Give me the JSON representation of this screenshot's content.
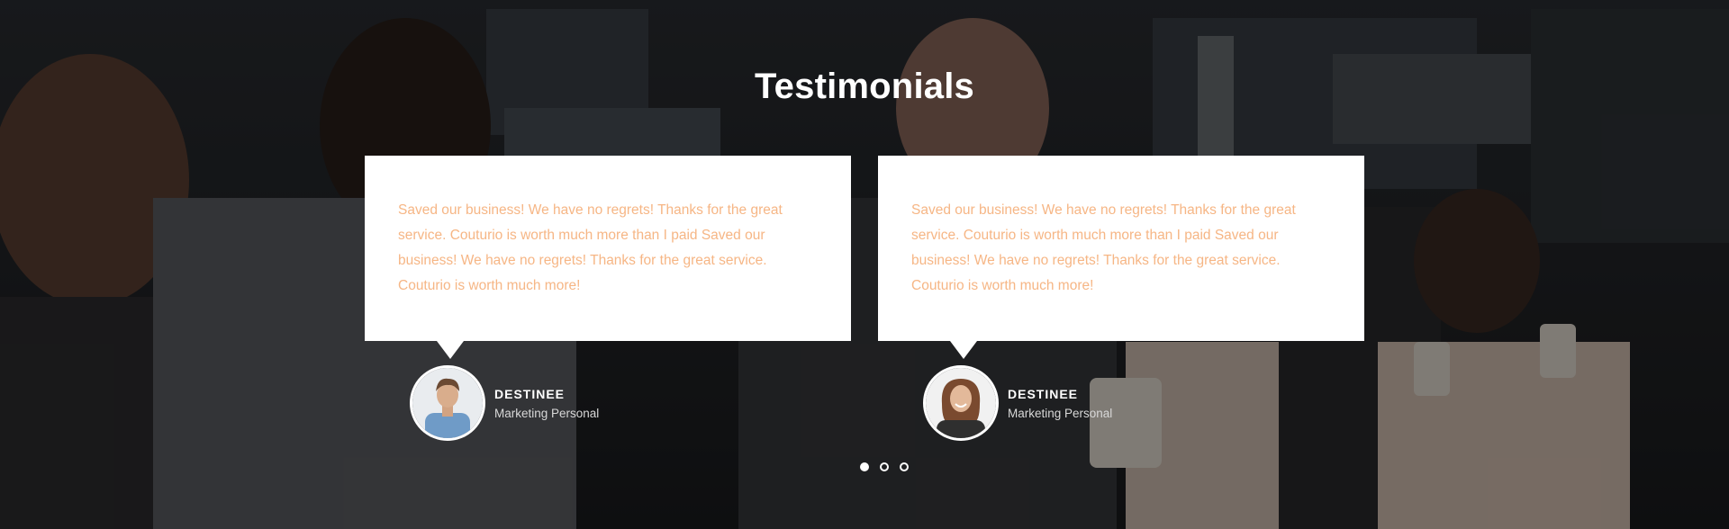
{
  "section": {
    "title": "Testimonials"
  },
  "testimonials": [
    {
      "quote": "Saved our business! We have no regrets! Thanks for the great service. Couturio is worth much more than I paid Saved our business! We have no regrets! Thanks for the great service. Couturio is worth much more!",
      "name": "DESTINEE",
      "role": "Marketing Personal",
      "avatar_icon": "male-avatar-photo"
    },
    {
      "quote": "Saved our business! We have no regrets! Thanks for the great service. Couturio is worth much more than I paid Saved our business! We have no regrets! Thanks for the great service. Couturio is worth much more!",
      "name": "DESTINEE",
      "role": "Marketing Personal",
      "avatar_icon": "female-avatar-photo"
    }
  ],
  "pagination": {
    "count": 3,
    "active_index": 0
  },
  "colors": {
    "quote_text": "#f6b685",
    "card_bg": "#ffffff",
    "title": "#ffffff"
  }
}
